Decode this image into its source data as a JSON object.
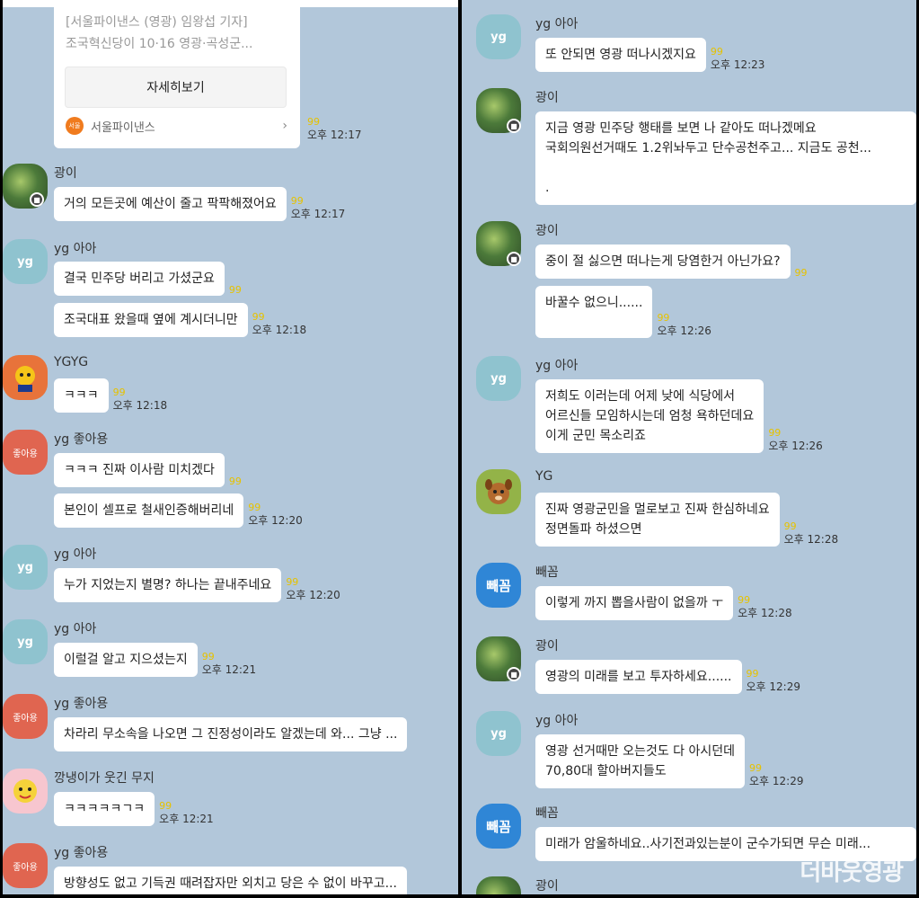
{
  "left": {
    "card": {
      "line1": "[서울파이낸스 (영광) 임왕섭 기자]",
      "line2": "조국혁신당이 10·16 영광·곡성군...",
      "button": "자세히보기",
      "source": "서울파이낸스",
      "source_logo": "서울",
      "unread": "99",
      "time": "오후 12:17"
    },
    "messages": [
      {
        "sender": "광이",
        "avatar": "salad-avatar",
        "text": "거의 모든곳에 예산이 줄고 팍팍해졌어요",
        "unread": "99",
        "time": "오후 12:17"
      },
      {
        "sender": "yg 아아",
        "avatar": "yg-avatar",
        "text": "결국 민주당 버리고 가셨군요",
        "unread": "99",
        "time": ""
      },
      {
        "sender": "",
        "text": "조국대표 왔을때 옆에 계시더니만",
        "unread": "99",
        "time": "오후 12:18"
      },
      {
        "sender": "YGYG",
        "avatar": "orange-avatar",
        "text": "ㅋㅋㅋ",
        "unread": "99",
        "time": "오후 12:18"
      },
      {
        "sender": "yg 좋아용",
        "avatar": "red-avatar",
        "text": "ㅋㅋㅋ 진짜 이사람 미치겠다",
        "unread": "99",
        "time": ""
      },
      {
        "sender": "",
        "text": "본인이 셀프로 철새인증해버리네",
        "unread": "99",
        "time": "오후 12:20"
      },
      {
        "sender": "yg 아아",
        "avatar": "yg-avatar",
        "text": "누가 지었는지 별명? 하나는 끝내주네요",
        "unread": "99",
        "time": "오후 12:20"
      },
      {
        "sender": "yg 아아",
        "avatar": "yg-avatar",
        "text": "이럴걸 알고 지으셨는지",
        "unread": "99",
        "time": "오후 12:21"
      },
      {
        "sender": "yg 좋아용",
        "avatar": "red-avatar",
        "text": "차라리 무소속을 나오면 그 진정성이라도 알겠는데 와... 그냥 ...",
        "unread": "",
        "time": ""
      },
      {
        "sender": "깡냉이가 웃긴 무지",
        "avatar": "pink-avatar",
        "text": "ㅋㅋㅋㅋㅋㄱㅋ",
        "unread": "99",
        "time": "오후 12:21"
      },
      {
        "sender": "yg 좋아용",
        "avatar": "red-avatar",
        "text": "방향성도 없고 기득권 때려잡자만 외치고 당은 수 없이 바꾸고...",
        "unread": "",
        "time": ""
      }
    ],
    "badge_label": "좋아용"
  },
  "right": {
    "messages": [
      {
        "sender": "yg 아아",
        "avatar": "yg-avatar",
        "text": "또 안되면 영광 떠나시겠지요",
        "unread": "99",
        "time": "오후 12:23"
      },
      {
        "sender": "광이",
        "avatar": "salad-avatar",
        "lines": [
          "지금 영광 민주당 행태를 보면 나 같아도 떠나겠메요",
          "국회의원선거때도 1.2위놔두고 단수공천주고... 지금도 공천...",
          "",
          "."
        ],
        "unread": "",
        "time": ""
      },
      {
        "sender": "광이",
        "avatar": "salad-avatar",
        "text": "중이 절 싫으면 떠나는게 당염한거 아닌가요?",
        "unread": "99",
        "time": ""
      },
      {
        "sender": "",
        "text": "바꿀수 없으니......",
        "unread": "99",
        "time": "오후 12:26"
      },
      {
        "sender": "yg 아아",
        "avatar": "yg-avatar",
        "lines": [
          "저희도 이러는데 어제 낮에 식당에서",
          "어르신들 모임하시는데 엄청 욕하던데요",
          "이게 군민 목소리죠"
        ],
        "unread": "99",
        "time": "오후 12:26"
      },
      {
        "sender": "YG",
        "avatar": "brown-avatar",
        "lines": [
          "진짜  영광군민을  멀로보고  진짜  한심하네요",
          "정면돌파  하셨으면"
        ],
        "unread": "99",
        "time": "오후 12:28"
      },
      {
        "sender": "빼꼼",
        "avatar": "blue-avatar",
        "text": "이렇게 까지 뽑을사람이 없을까 ㅜ",
        "unread": "99",
        "time": "오후 12:28"
      },
      {
        "sender": "광이",
        "avatar": "salad-avatar",
        "text": "영광의 미래를 보고 투자하세요......",
        "unread": "99",
        "time": "오후 12:29"
      },
      {
        "sender": "yg 아아",
        "avatar": "yg-avatar",
        "lines": [
          "영광 선거때만 오는것도 다 아시던데",
          "70,80대 할아버지들도"
        ],
        "unread": "99",
        "time": "오후 12:29"
      },
      {
        "sender": "빼꼼",
        "avatar": "blue-avatar",
        "text": "미래가 암울하네요..사기전과있는분이 군수가되면 무슨 미래...",
        "unread": "",
        "time": ""
      },
      {
        "sender": "광이",
        "avatar": "salad-avatar",
        "text": "",
        "unread": "",
        "time": ""
      }
    ],
    "blue_avatar_label": "빼꼼"
  },
  "yg_avatar_label": "yg",
  "watermark": "더바웃영광"
}
